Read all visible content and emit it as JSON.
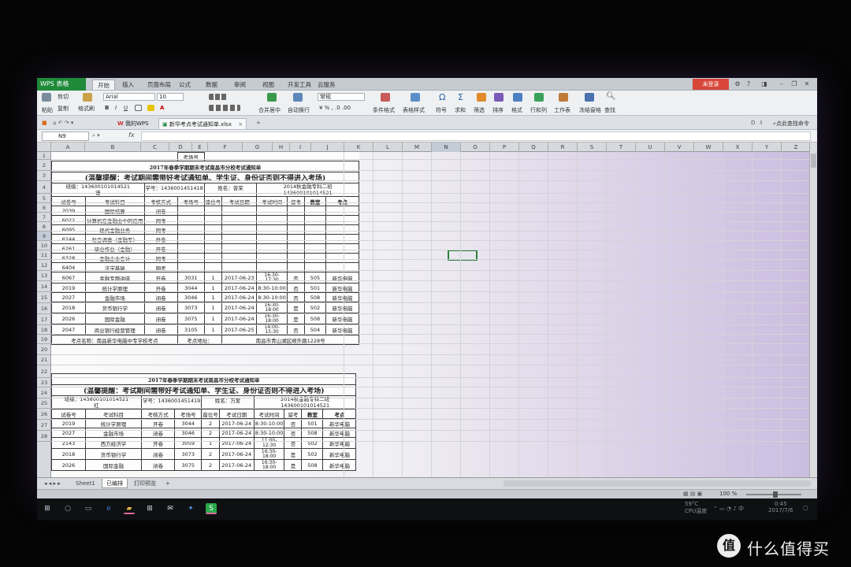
{
  "app": {
    "brand": "WPS 表格",
    "login_button": "未登录"
  },
  "menu_tabs": [
    "开始",
    "插入",
    "页面布局",
    "公式",
    "数据",
    "审阅",
    "视图",
    "开发工具",
    "云服务"
  ],
  "ribbon": {
    "cut": "剪切",
    "paste": "粘贴",
    "copy": "复制",
    "format_painter": "格式刷",
    "font_name": "Arial",
    "font_size": "10",
    "number_format": "常规",
    "merge_center": "合并居中",
    "wrap_text": "自动换行",
    "conditional_format": "条件格式",
    "table_style": "表格样式",
    "symbol": "符号",
    "sum": "求和",
    "filter": "筛选",
    "sort": "排序",
    "format": "格式",
    "rows_cols": "行和列",
    "worksheet": "工作表",
    "freeze": "冻结窗格",
    "find": "查找"
  },
  "doc_tabs": {
    "home": "我的WPS",
    "file": "新华考点考试通知单.xlsx",
    "search": "点此查找命令"
  },
  "formula_bar": {
    "name_box": "N9",
    "fx": "fx"
  },
  "columns": [
    "A",
    "B",
    "C",
    "D",
    "E",
    "F",
    "G",
    "H",
    "I",
    "J",
    "K",
    "L",
    "M",
    "N",
    "O",
    "P",
    "Q",
    "R",
    "S",
    "T",
    "U",
    "V",
    "W",
    "X",
    "Y",
    "Z"
  ],
  "rows": [
    "1",
    "2",
    "3",
    "4",
    "5",
    "6",
    "7",
    "8",
    "9",
    "10",
    "11",
    "12",
    "13",
    "14",
    "15",
    "16",
    "17",
    "18",
    "19",
    "20",
    "21",
    "22",
    "23",
    "24",
    "25",
    "26",
    "27",
    "28"
  ],
  "notices": [
    {
      "top_label": "考场号",
      "title": "2017年春季学期期末考试南昌市分校考试通知单",
      "reminder": "(温馨提醒：考试期间需带好考试通知单、学生证、身份证否则不得进入考场)",
      "class_info": "班级：143600101014521",
      "student_no": "学号：1436001451418",
      "name": "姓名：曾荣",
      "major_line1": "2014秋金融专科二班",
      "major_line2": "143600101014521",
      "name_overflow": "谨",
      "headers": [
        "试卷号",
        "考试科目",
        "考核方式",
        "考场号",
        "座位号",
        "考试日期",
        "考试时间",
        "留考",
        "教室",
        "考点"
      ],
      "rows": [
        [
          "2039",
          "国际结算",
          "闭卷",
          "",
          "",
          "",
          "",
          "",
          "",
          ""
        ],
        [
          "6022",
          "计算机在金融业中的应用",
          "网考",
          "",
          "",
          "",
          "",
          "",
          "",
          ""
        ],
        [
          "6095",
          "现代金融业务",
          "网考",
          "",
          "",
          "",
          "",
          "",
          "",
          ""
        ],
        [
          "6244",
          "社会调查（金融专）",
          "开卷",
          "",
          "",
          "",
          "",
          "",
          "",
          ""
        ],
        [
          "6261",
          "毕业作业（金融）",
          "开卷",
          "",
          "",
          "",
          "",
          "",
          "",
          ""
        ],
        [
          "6328",
          "金融企业会计",
          "网考",
          "",
          "",
          "",
          "",
          "",
          "",
          ""
        ],
        [
          "6404",
          "法学基础",
          "网考",
          "",
          "",
          "",
          "",
          "",
          "",
          ""
        ],
        [
          "6067",
          "金融专题讲座",
          "开卷",
          "3031",
          "1",
          "2017-06-23",
          "16:30-17:30",
          "否",
          "505",
          "新华电脑"
        ],
        [
          "2019",
          "统计学原理",
          "开卷",
          "3044",
          "1",
          "2017-06-24",
          "8:30-10:00",
          "否",
          "501",
          "新华电脑"
        ],
        [
          "2027",
          "金融市场",
          "闭卷",
          "3046",
          "1",
          "2017-06-24",
          "8:30-10:00",
          "否",
          "508",
          "新华电脑"
        ],
        [
          "2018",
          "货币银行学",
          "闭卷",
          "3073",
          "1",
          "2017-06-24",
          "16:30-18:00",
          "是",
          "502",
          "新华电脑"
        ],
        [
          "2026",
          "国际金融",
          "闭卷",
          "3075",
          "1",
          "2017-06-24",
          "16:30-18:00",
          "是",
          "508",
          "新华电脑"
        ],
        [
          "2047",
          "商业银行经营管理",
          "闭卷",
          "3105",
          "1",
          "2017-06-25",
          "14:00-15:30",
          "否",
          "504",
          "新华电脑"
        ]
      ],
      "footer_left": "考点名称：南昌新华电脑中专学校考点",
      "footer_mid": "考点地址：",
      "footer_right": "南昌市青山湖区顺外路1228号"
    },
    {
      "title": "2017年春季学期期末考试南昌市分校考试通知单",
      "reminder": "(温馨提醒：考试期间需带好考试通知单、学生证、身份证否则不得进入考场)",
      "class_info": "班级：143600101014521",
      "student_no": "学号：1436001451419",
      "name": "姓名：万爱",
      "major_line1": "2014秋金融专科二班",
      "major_line2": "143600101014521",
      "name_overflow": "红",
      "headers": [
        "试卷号",
        "考试科目",
        "考核方式",
        "考场号",
        "座位号",
        "考试日期",
        "考试时间",
        "留考",
        "教室",
        "考点"
      ],
      "rows": [
        [
          "2019",
          "统计学原理",
          "开卷",
          "3044",
          "2",
          "2017-06-24",
          "8:30-10:00",
          "否",
          "501",
          "新华电脑"
        ],
        [
          "2027",
          "金融市场",
          "闭卷",
          "3046",
          "2",
          "2017-06-24",
          "8:30-10:00",
          "否",
          "508",
          "新华电脑"
        ],
        [
          "2143",
          "西方经济学",
          "开卷",
          "3059",
          "1",
          "2017-06-24",
          "11:00-12:30",
          "否",
          "502",
          "新华电脑"
        ],
        [
          "2018",
          "货币银行学",
          "闭卷",
          "3073",
          "2",
          "2017-06-24",
          "16:30-18:00",
          "是",
          "502",
          "新华电脑"
        ],
        [
          "2026",
          "国际金融",
          "闭卷",
          "3075",
          "2",
          "2017-06-24",
          "16:30-18:00",
          "是",
          "508",
          "新华电脑"
        ]
      ]
    }
  ],
  "sheet_tabs": [
    "Sheet1",
    "已编排",
    "打印预览"
  ],
  "status": {
    "zoom": "100 %"
  },
  "taskbar": {
    "temp": "59°C",
    "cpu": "CPU温度",
    "time": "0:45",
    "date": "2017/7/6"
  },
  "watermark": {
    "logo": "值",
    "text": "什么值得买"
  }
}
